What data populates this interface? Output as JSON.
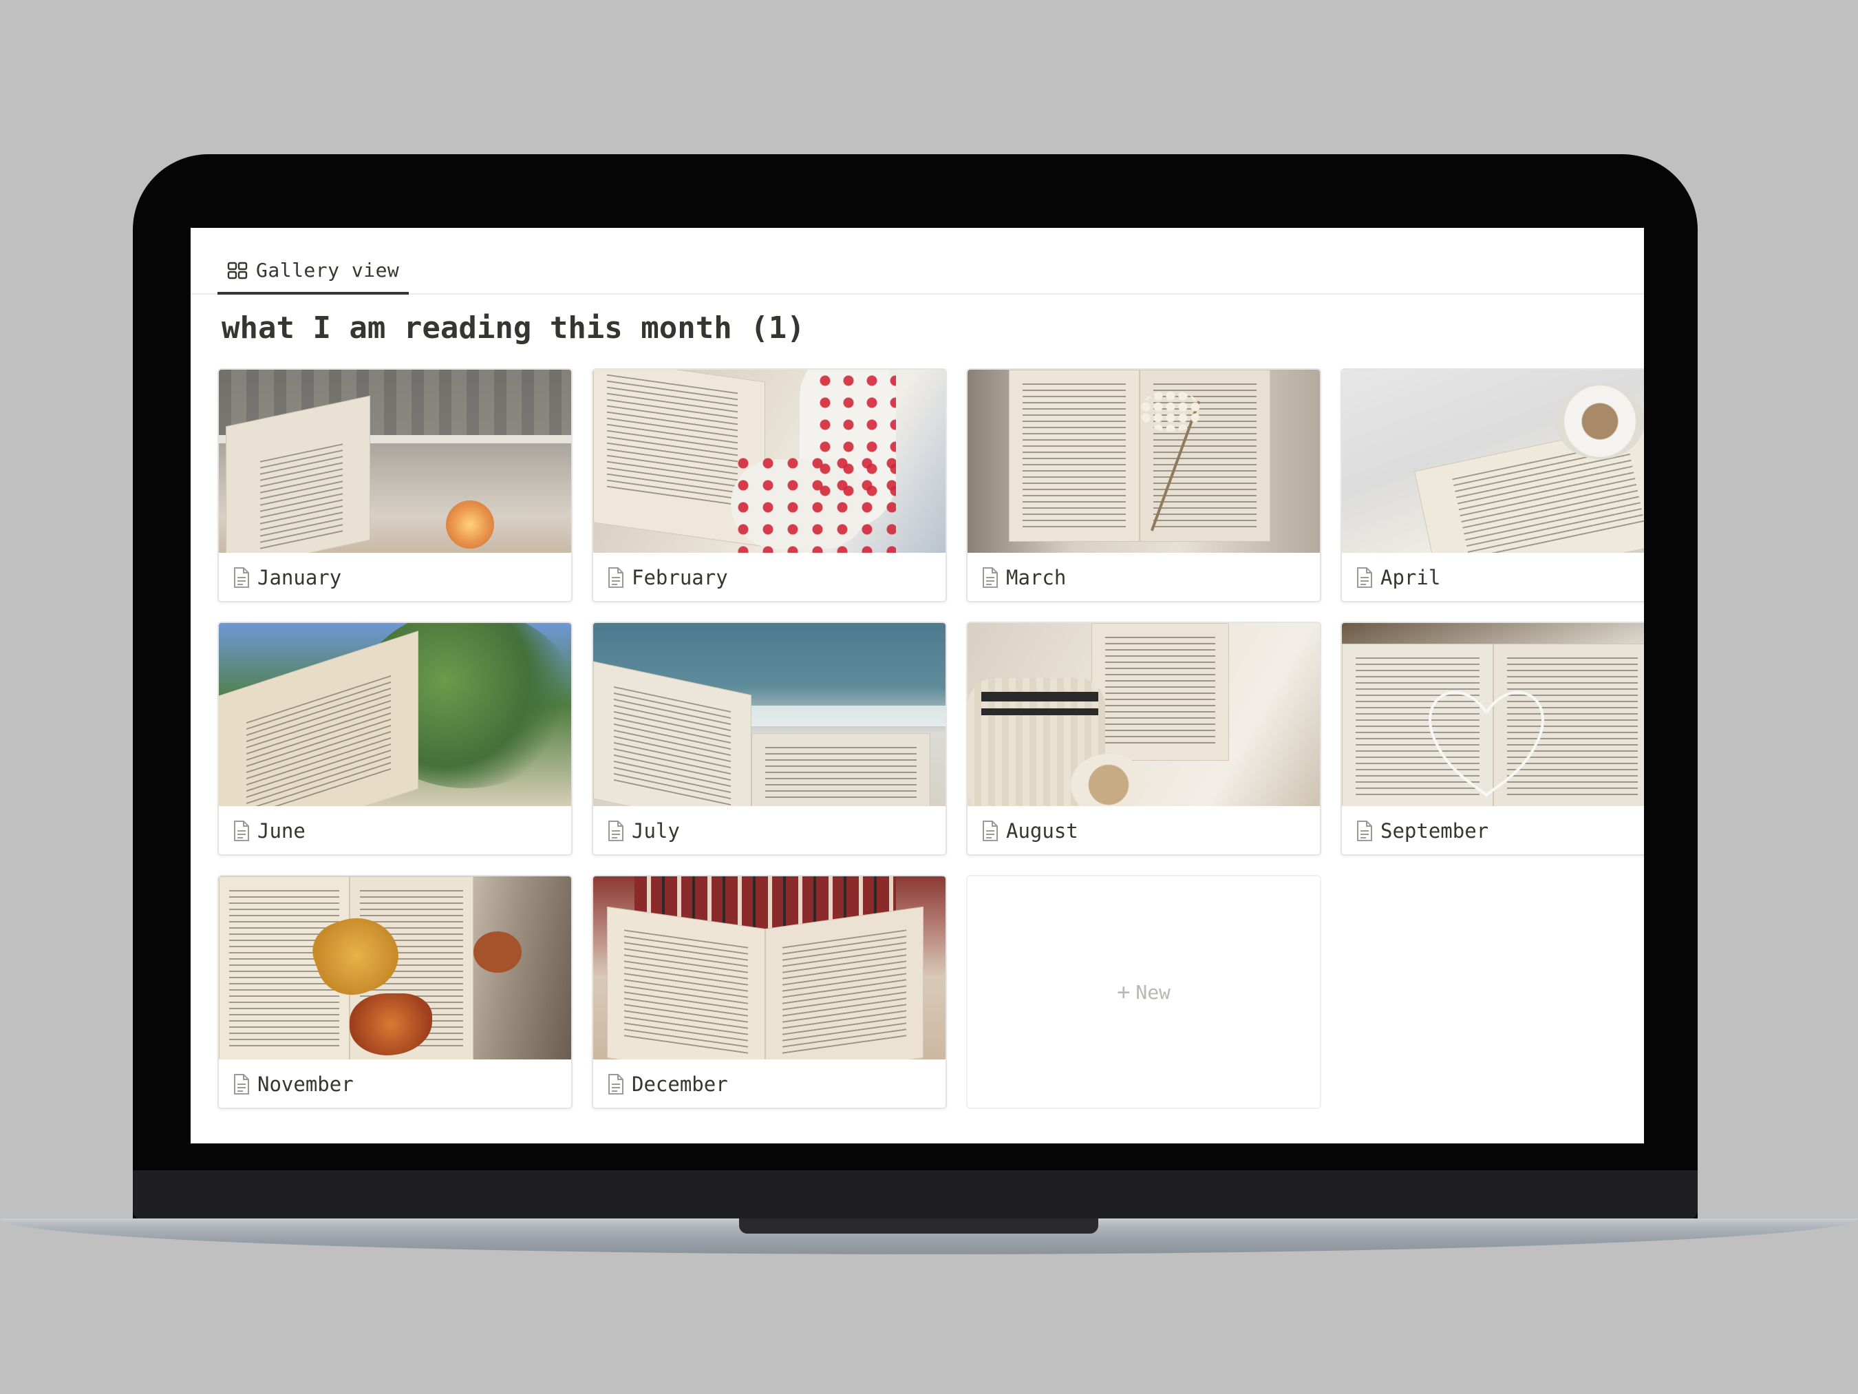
{
  "view_tab": {
    "label": "Gallery view",
    "icon": "gallery-grid-icon"
  },
  "database": {
    "title": "what I am reading this month (1)"
  },
  "cards": [
    {
      "label": "January",
      "icon": "page-icon",
      "cover": "book-by-rainy-window-candle"
    },
    {
      "label": "February",
      "icon": "page-icon",
      "cover": "book-with-heart-socks"
    },
    {
      "label": "March",
      "icon": "page-icon",
      "cover": "book-with-dried-flowers"
    },
    {
      "label": "April",
      "icon": "page-icon",
      "cover": "book-with-coffee-on-sheets"
    },
    {
      "label": "June",
      "icon": "page-icon",
      "cover": "book-under-trees-blue-sky"
    },
    {
      "label": "July",
      "icon": "page-icon",
      "cover": "book-at-the-beach"
    },
    {
      "label": "August",
      "icon": "page-icon",
      "cover": "book-with-knit-sweater-latte"
    },
    {
      "label": "September",
      "icon": "page-icon",
      "cover": "book-with-earphones-heart"
    },
    {
      "label": "November",
      "icon": "page-icon",
      "cover": "book-with-autumn-leaves"
    },
    {
      "label": "December",
      "icon": "page-icon",
      "cover": "book-on-plaid-pajamas"
    }
  ],
  "new_card": {
    "label": "New",
    "icon": "plus-icon"
  }
}
